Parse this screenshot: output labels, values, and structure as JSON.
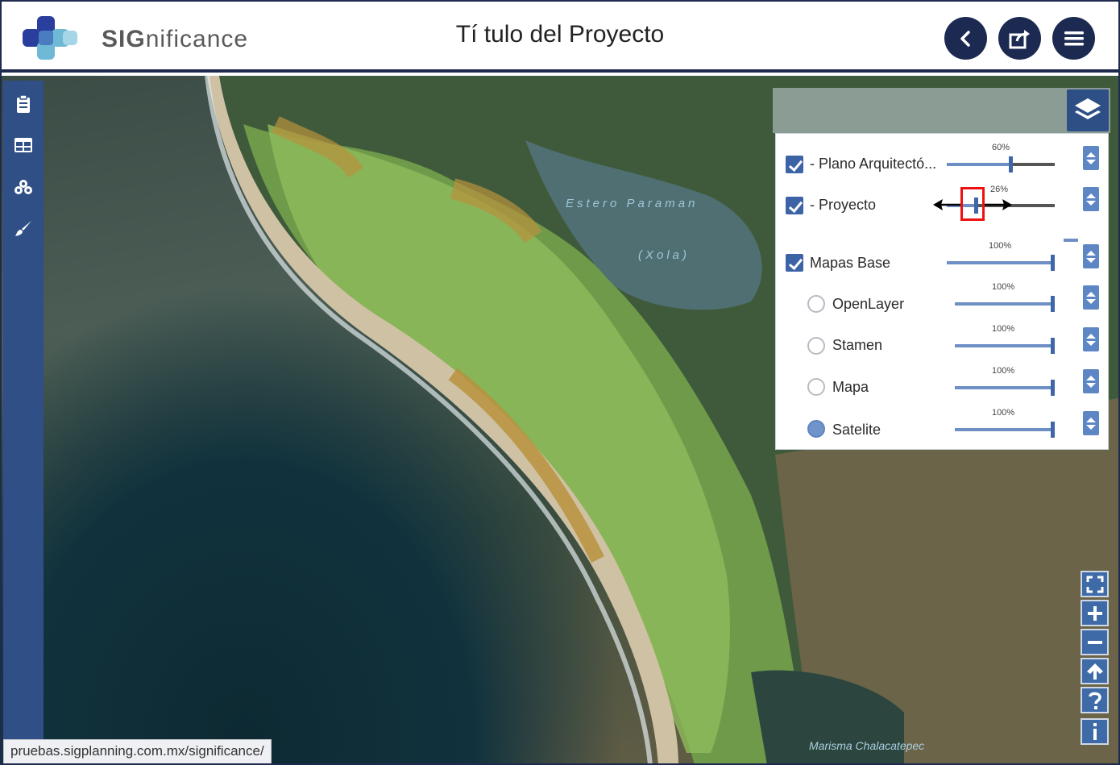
{
  "app": {
    "brand_prefix": "SIG",
    "brand_suffix": "nificance",
    "title": "Tí tulo del Proyecto"
  },
  "header_buttons": [
    "back-icon",
    "share-icon",
    "menu-icon"
  ],
  "sidebar_icons": [
    "clipboard-icon",
    "table-icon",
    "layers-stack-icon",
    "brush-icon"
  ],
  "map": {
    "label_estero": "Estero Paraman",
    "label_xola": "(Xola)",
    "label_marisma": "Marisma Chalacatepec"
  },
  "layers": [
    {
      "label": "- Plano Arquitectó...",
      "control": "checkbox",
      "checked": true,
      "opacity_label": "60%",
      "opacity": 0.6
    },
    {
      "label": "- Proyecto",
      "control": "checkbox",
      "checked": true,
      "opacity_label": "26%",
      "opacity": 0.26
    },
    {
      "label": "Mapas Base",
      "control": "checkbox",
      "checked": true,
      "opacity_label": "100%",
      "opacity": 1.0
    },
    {
      "label": "OpenLayer",
      "control": "radio",
      "checked": false,
      "opacity_label": "100%",
      "opacity": 1.0
    },
    {
      "label": "Stamen",
      "control": "radio",
      "checked": false,
      "opacity_label": "100%",
      "opacity": 1.0
    },
    {
      "label": "Mapa",
      "control": "radio",
      "checked": false,
      "opacity_label": "100%",
      "opacity": 1.0
    },
    {
      "label": "Satelite",
      "control": "radio",
      "checked": true,
      "opacity_label": "100%",
      "opacity": 1.0
    }
  ],
  "map_controls": [
    "fullscreen-icon",
    "zoom-in-icon",
    "zoom-out-icon",
    "north-arrow-icon",
    "help-icon",
    "info-icon"
  ],
  "status": {
    "url": "pruebas.sigplanning.com.mx/significance/"
  },
  "colors": {
    "navy": "#1c2a52",
    "sidebar": "#2f4f86",
    "accent": "#3f66a8",
    "annotation": "#ee1111"
  }
}
